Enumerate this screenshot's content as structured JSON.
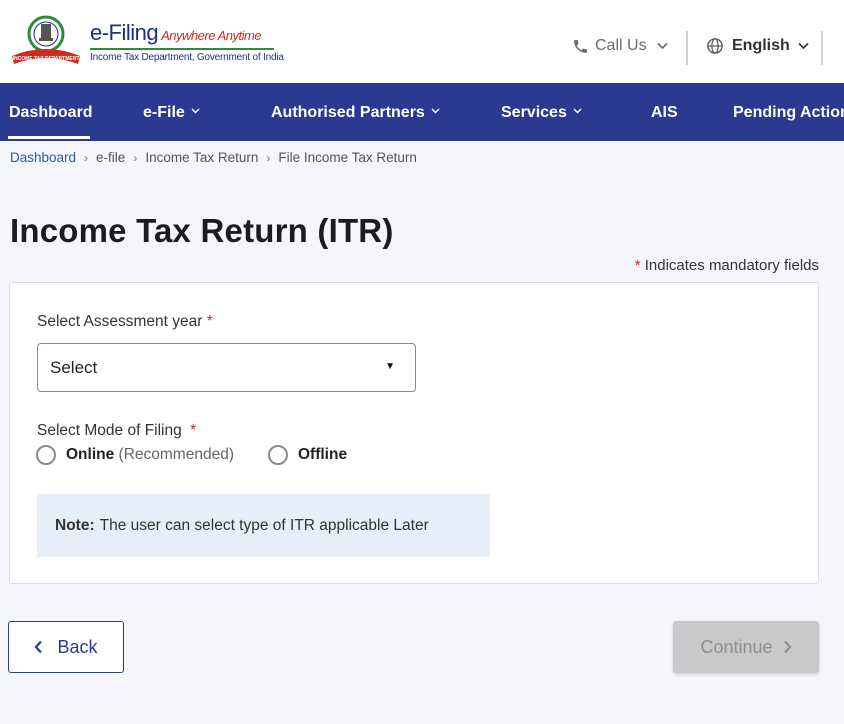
{
  "header": {
    "brand_title": "e-Filing",
    "brand_tagline": "Anywhere Anytime",
    "brand_subtitle": "Income Tax Department, Government of India",
    "emblem_text": "INCOME TAX DEPARTMENT",
    "call_us": "Call Us",
    "language": "English"
  },
  "nav": {
    "items": [
      {
        "label": "Dashboard",
        "active": true
      },
      {
        "label": "e-File",
        "dropdown": true
      },
      {
        "label": "Authorised Partners",
        "dropdown": true
      },
      {
        "label": "Services",
        "dropdown": true
      },
      {
        "label": "AIS"
      },
      {
        "label": "Pending Actions"
      }
    ]
  },
  "breadcrumb": [
    "Dashboard",
    "e-file",
    "Income Tax Return",
    "File Income Tax Return"
  ],
  "page": {
    "title": "Income Tax Return (ITR)",
    "mandatory_note": "Indicates mandatory fields",
    "required_mark": "*"
  },
  "form": {
    "assessment_year_label": "Select Assessment year",
    "assessment_year_value": "Select",
    "mode_label": "Select Mode of Filing",
    "mode_online": "Online",
    "mode_online_hint": "(Recommended)",
    "mode_offline": "Offline",
    "note_label": "Note:",
    "note_text": "The user can select type of ITR applicable Later"
  },
  "buttons": {
    "back": "Back",
    "continue": "Continue"
  },
  "colors": {
    "nav_bg": "#2b3990",
    "required": "#d12a1f",
    "note_bg": "#e6eefb",
    "continue_disabled": "#c9c9cb"
  }
}
